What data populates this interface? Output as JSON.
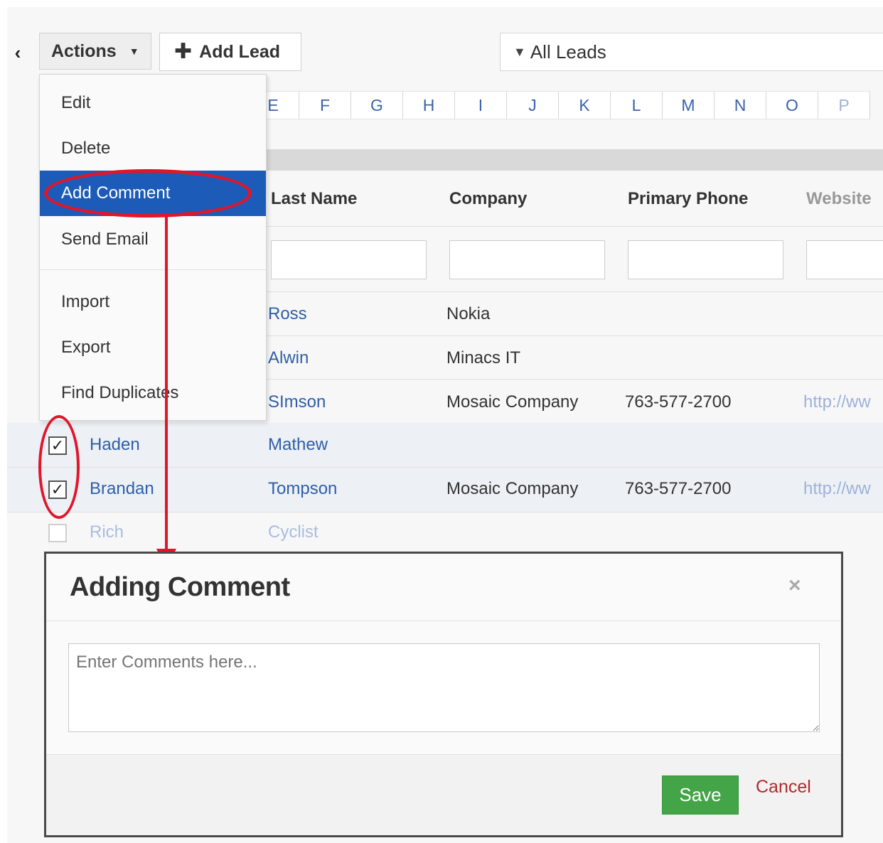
{
  "toolbar": {
    "back_icon": "chevron-left-icon",
    "actions_label": "Actions",
    "add_lead_label": "Add Lead",
    "filter_label": "All Leads"
  },
  "alphabet": [
    "E",
    "F",
    "G",
    "H",
    "I",
    "J",
    "K",
    "L",
    "M",
    "N",
    "O",
    "P"
  ],
  "columns": {
    "last_name": "Last Name",
    "company": "Company",
    "primary_phone": "Primary Phone",
    "website": "Website"
  },
  "rows": [
    {
      "first": "",
      "last": "Ross",
      "company": "Nokia",
      "phone": "",
      "website": "",
      "checked": false
    },
    {
      "first": "",
      "last": "Alwin",
      "company": "Minacs IT",
      "phone": "",
      "website": "",
      "checked": false
    },
    {
      "first": "",
      "last": "SImson",
      "company": "Mosaic Company",
      "phone": "763-577-2700",
      "website": "http://ww",
      "checked": false
    },
    {
      "first": "Haden",
      "last": "Mathew",
      "company": "",
      "phone": "",
      "website": "",
      "checked": true
    },
    {
      "first": "Brandan",
      "last": "Tompson",
      "company": "Mosaic Company",
      "phone": "763-577-2700",
      "website": "http://ww",
      "checked": true
    },
    {
      "first": "Rich",
      "last": "Cyclist",
      "company": "",
      "phone": "",
      "website": "",
      "checked": false
    }
  ],
  "actions_menu": {
    "items": [
      "Edit",
      "Delete",
      "Add Comment",
      "Send Email",
      "Import",
      "Export",
      "Find Duplicates"
    ],
    "selected": "Add Comment"
  },
  "modal": {
    "title": "Adding Comment",
    "close_glyph": "×",
    "placeholder": "Enter Comments here...",
    "save_label": "Save",
    "cancel_label": "Cancel"
  },
  "colors": {
    "menu_active": "#1d5bb8",
    "annotation_red": "#e0162b",
    "save_green": "#43a547",
    "link_blue": "#2f5fa8"
  }
}
